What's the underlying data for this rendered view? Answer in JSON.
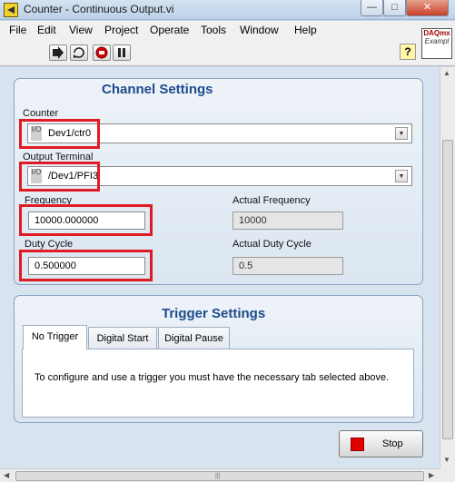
{
  "window": {
    "title": "Counter - Continuous Output.vi",
    "minimize": "—",
    "maximize": "□",
    "close": "✕"
  },
  "menu": [
    "File",
    "Edit",
    "View",
    "Project",
    "Operate",
    "Tools",
    "Window",
    "Help"
  ],
  "toolbar": {
    "icons": [
      "run-continuously-icon",
      "abort-execution-icon",
      "pause-icon"
    ],
    "help_glyph": "?",
    "logo_line1": "DAQmx",
    "logo_line2": "Exampl"
  },
  "channel_settings": {
    "title": "Channel Settings",
    "counter_label": "Counter",
    "counter_value": "Dev1/ctr0",
    "output_terminal_label": "Output Terminal",
    "output_terminal_value": "/Dev1/PFI3",
    "frequency_label": "Frequency",
    "frequency_value": "10000.000000",
    "actual_frequency_label": "Actual Frequency",
    "actual_frequency_value": "10000",
    "duty_cycle_label": "Duty Cycle",
    "duty_cycle_value": "0.500000",
    "actual_duty_cycle_label": "Actual Duty Cycle",
    "actual_duty_cycle_value": "0.5"
  },
  "trigger_settings": {
    "title": "Trigger Settings",
    "tabs": [
      "No Trigger",
      "Digital Start",
      "Digital Pause"
    ],
    "active_tab": "No Trigger",
    "message": "To configure and use a trigger you must have the necessary tab selected above."
  },
  "stop_button": {
    "label": "Stop"
  },
  "io_glyph": "I/O",
  "dropdown_glyph": "▼",
  "colors": {
    "highlight": "#e01b24",
    "group_title": "#1e4b8c",
    "stop": "#e00000"
  }
}
